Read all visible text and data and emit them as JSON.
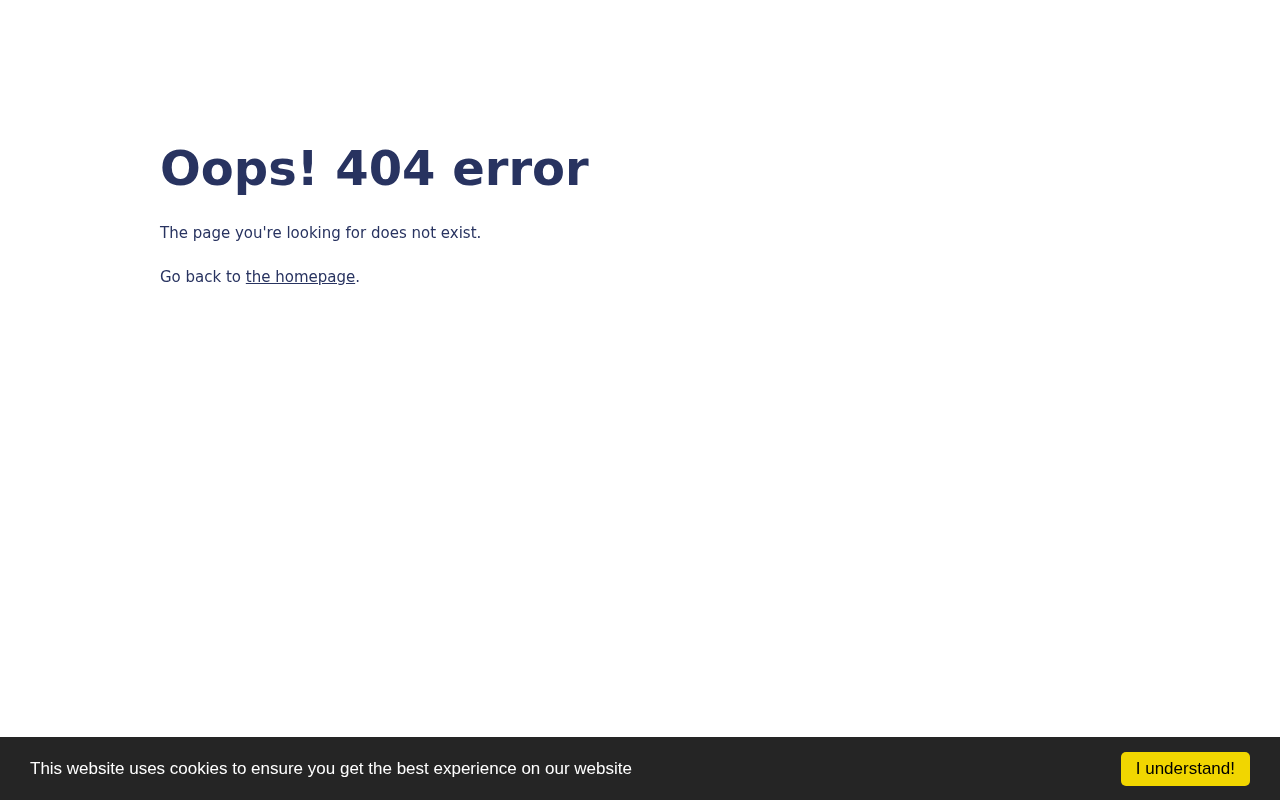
{
  "heading": "Oops! 404 error",
  "message": "The page you're looking for does not exist.",
  "back": {
    "before": "Go back to ",
    "link": "the homepage",
    "after": "."
  },
  "cookie_banner": {
    "text": "This website uses cookies to ensure you get the best experience on our website",
    "button": "I understand!"
  }
}
